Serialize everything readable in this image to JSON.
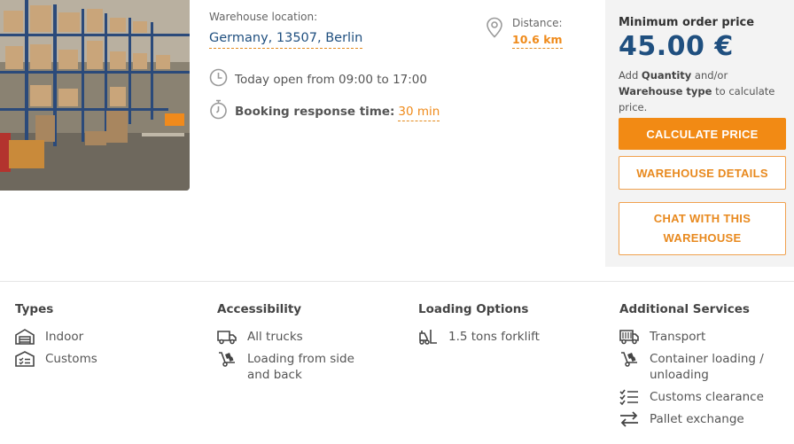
{
  "location": {
    "label": "Warehouse location:",
    "value": "Germany, 13507, Berlin"
  },
  "distance": {
    "label": "Distance:",
    "value": "10.6 km"
  },
  "hours": "Today open from 09:00 to 17:00",
  "booking": {
    "label": "Booking response time:",
    "value": "30 min"
  },
  "pricing": {
    "title": "Minimum order price",
    "price": "45.00 €",
    "note_1": "Add ",
    "note_quantity": "Quantity",
    "note_2": " and/or ",
    "note_type": "Warehouse type",
    "note_3": " to calculate price.",
    "calculate_label": "CALCULATE PRICE",
    "details_label": "WAREHOUSE DETAILS",
    "chat_label": "CHAT WITH THIS WAREHOUSE"
  },
  "features": {
    "types": {
      "title": "Types",
      "items": [
        {
          "label": "Indoor",
          "icon": "warehouse-icon"
        },
        {
          "label": "Customs",
          "icon": "customs-icon"
        }
      ]
    },
    "accessibility": {
      "title": "Accessibility",
      "items": [
        {
          "label": "All trucks",
          "icon": "truck-icon"
        },
        {
          "label": "Loading from side and back",
          "icon": "hand-truck-icon"
        }
      ]
    },
    "loading": {
      "title": "Loading Options",
      "items": [
        {
          "label": "1.5 tons forklift",
          "icon": "forklift-icon"
        }
      ]
    },
    "services": {
      "title": "Additional Services",
      "items": [
        {
          "label": "Transport",
          "icon": "transport-truck-icon"
        },
        {
          "label": "Container loading / unloading",
          "icon": "hand-truck-icon"
        },
        {
          "label": "Customs clearance",
          "icon": "checklist-icon"
        },
        {
          "label": "Pallet exchange",
          "icon": "exchange-arrows-icon"
        }
      ]
    }
  },
  "colors": {
    "accent": "#f28a14",
    "link": "#1f4f7f",
    "panel": "#f3f3f3"
  }
}
